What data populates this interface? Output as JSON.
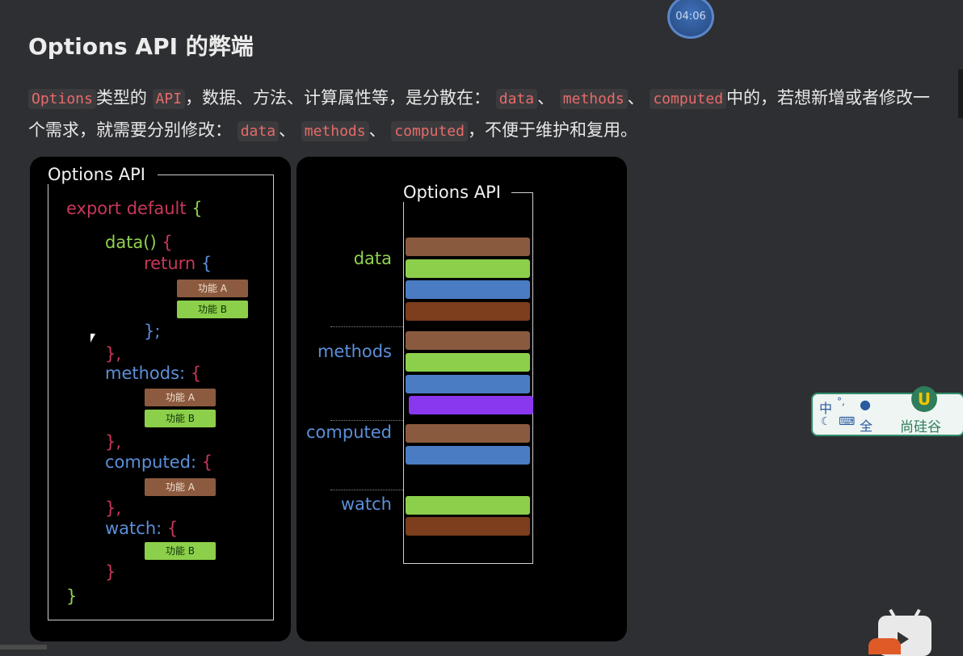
{
  "timer": "04:06",
  "heading": "Options API 的弊端",
  "paragraph": {
    "t1": "Options",
    "t2": "类型的",
    "t3": "API",
    "t4": "，数据、方法、计算属性等，是分散在：",
    "t5": "data",
    "t6": "、",
    "t7": "methods",
    "t8": "、",
    "t9": "computed",
    "t10": "中的，若想新增或者修改一个需求，就需要分别修改：",
    "t11": "data",
    "t12": "、",
    "t13": "methods",
    "t14": "、",
    "t15": "computed",
    "t16": "，不便于维护和复用。"
  },
  "left_diagram": {
    "title": "Options API",
    "export_line": "export default {",
    "export_kw": "export",
    "default_kw": "default",
    "open_brace": "{",
    "data_fn": "data()",
    "data_brace": "{",
    "return_kw": "return",
    "return_brace": "{",
    "return_close": "};",
    "data_close": "},",
    "methods_key": "methods:",
    "methods_brace": "{",
    "methods_close": "},",
    "computed_key": "computed:",
    "computed_brace": "{",
    "computed_close": "},",
    "watch_key": "watch:",
    "watch_brace": "{",
    "watch_close": "}",
    "final_close": "}",
    "feature_a": "功能 A",
    "feature_b": "功能 B"
  },
  "right_diagram": {
    "title": "Options API",
    "labels": [
      "data",
      "methods",
      "computed",
      "watch"
    ],
    "colors": {
      "brown": "#8a5a3e",
      "green": "#8ccf4a",
      "blue": "#4a7cc4",
      "rust": "#7c3e1d",
      "purple": "#8a37f0"
    }
  },
  "ime": {
    "zh": "中",
    "full": "全",
    "brand": "尚硅谷",
    "logo": "U"
  }
}
